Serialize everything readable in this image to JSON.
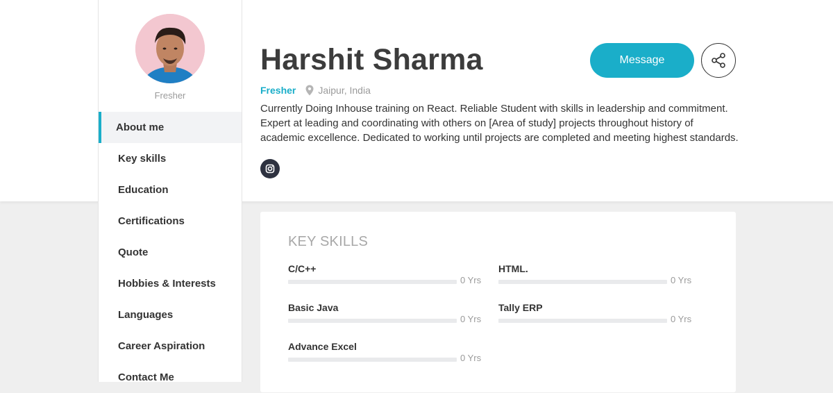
{
  "profile": {
    "name": "Harshit Sharma",
    "avatar_status": "Fresher",
    "role": "Fresher",
    "location": "Jaipur, India",
    "bio": "Currently Doing Inhouse training on React. Reliable Student with skills in leadership and commitment. Expert at leading and coordinating with others on [Area of study] projects throughout history of academic excellence. Dedicated to working until projects are completed and meeting highest standards.",
    "social": [
      {
        "icon": "instagram-icon"
      }
    ]
  },
  "actions": {
    "message_label": "Message",
    "share_icon": "share-icon"
  },
  "sidebar": {
    "items": [
      {
        "label": "About me",
        "active": true
      },
      {
        "label": "Key skills",
        "active": false
      },
      {
        "label": "Education",
        "active": false
      },
      {
        "label": "Certifications",
        "active": false
      },
      {
        "label": "Quote",
        "active": false
      },
      {
        "label": "Hobbies & Interests",
        "active": false
      },
      {
        "label": "Languages",
        "active": false
      },
      {
        "label": "Career Aspiration",
        "active": false
      },
      {
        "label": "Contact Me",
        "active": false
      }
    ]
  },
  "skills": {
    "title": "KEY SKILLS",
    "items": [
      {
        "name": "C/C++",
        "years": "0 Yrs",
        "level": 0
      },
      {
        "name": "HTML.",
        "years": "0 Yrs",
        "level": 0
      },
      {
        "name": "Basic Java",
        "years": "0 Yrs",
        "level": 0
      },
      {
        "name": "Tally ERP",
        "years": "0 Yrs",
        "level": 0
      },
      {
        "name": "Advance Excel",
        "years": "0 Yrs",
        "level": 0
      }
    ]
  },
  "colors": {
    "accent": "#1aaec9",
    "dark_icon_bg": "#2e3240",
    "page_bg": "#efefef"
  }
}
